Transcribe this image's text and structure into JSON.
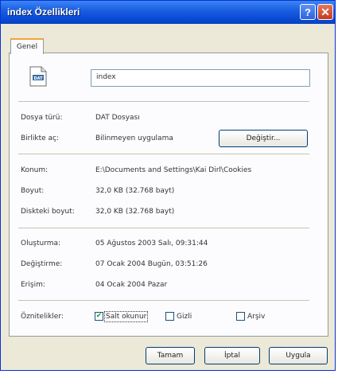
{
  "window": {
    "title": "index Özellikleri",
    "help_label": "?",
    "close_label": "✕"
  },
  "tabs": [
    {
      "label": "Genel",
      "selected": true
    }
  ],
  "file": {
    "icon": "dat-file-icon",
    "icon_text": "DAT",
    "name": "index"
  },
  "type_info": {
    "type_label": "Dosya türü:",
    "type_value": "DAT Dosyası",
    "opens_label": "Birlikte aç:",
    "opens_value": "Bilinmeyen uygulama",
    "change_button": "Değiştir..."
  },
  "location": {
    "location_label": "Konum:",
    "location_value": "E:\\Documents and Settings\\Kai Dirl\\Cookies",
    "size_label": "Boyut:",
    "size_value": "32,0 KB (32.768 bayt)",
    "disk_size_label": "Diskteki boyut:",
    "disk_size_value": "32,0 KB (32.768 bayt)"
  },
  "dates": {
    "created_label": "Oluşturma:",
    "created_value": "05 Ağustos 2003 Salı, 09:31:44",
    "modified_label": "Değiştirme:",
    "modified_value": "07 Ocak 2004 Bugün, 03:51:26",
    "accessed_label": "Erişim:",
    "accessed_value": "04 Ocak 2004 Pazar"
  },
  "attributes": {
    "label": "Öznitelikler:",
    "items": [
      {
        "label": "Salt okunur",
        "checked": true
      },
      {
        "label": "Gizli",
        "checked": false
      },
      {
        "label": "Arşiv",
        "checked": false
      }
    ]
  },
  "footer": {
    "ok": "Tamam",
    "cancel": "İptal",
    "apply": "Uygula"
  },
  "colors": {
    "titlebar": "#0a4bd6",
    "accent_tab": "#f2a43a",
    "check_mark": "#21a121"
  }
}
